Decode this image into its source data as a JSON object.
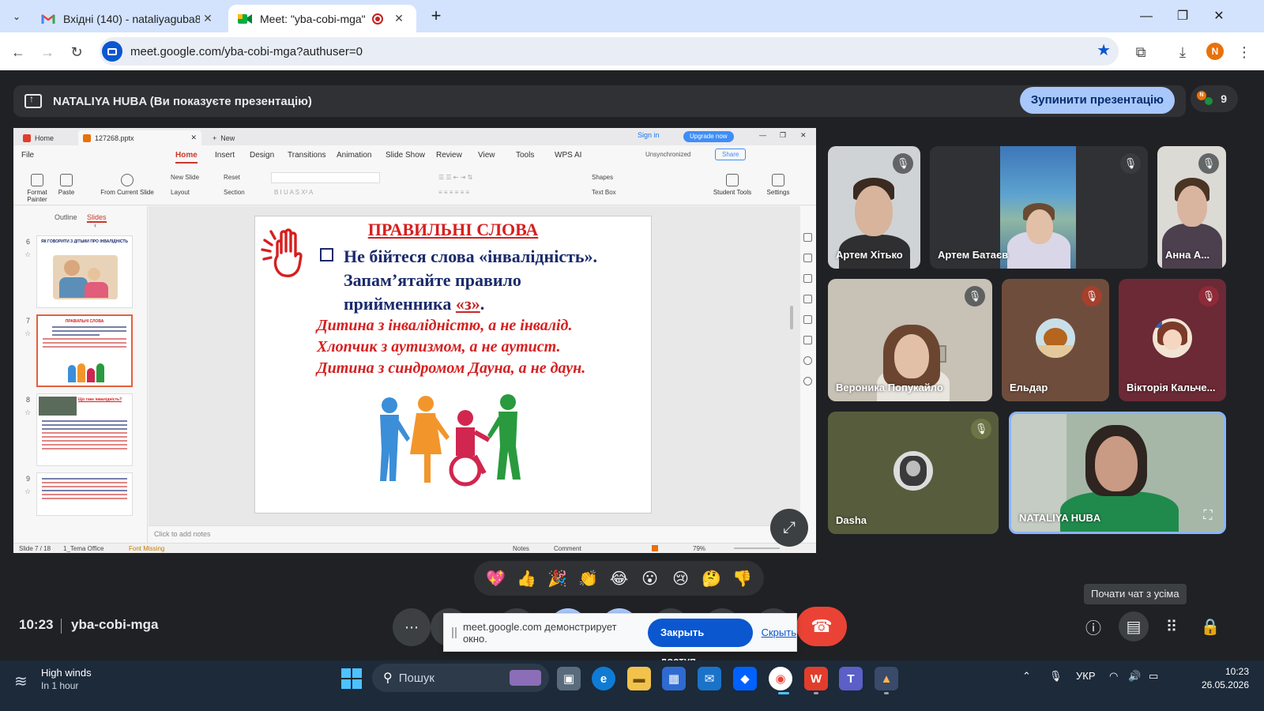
{
  "browser": {
    "tabs": [
      {
        "title": "Вхідні (140) - nataliyaguba85@",
        "active": false
      },
      {
        "title": "Meet: \"yba-cobi-mga\"",
        "active": true
      }
    ],
    "url": "meet.google.com/yba-cobi-mga?authuser=0",
    "profile_initial": "N"
  },
  "meet": {
    "presenter_banner": "NATALIYA HUBA (Ви показуєте презентацію)",
    "stop_presenting": "Зупинити презентацію",
    "participant_count": "9",
    "meeting_time": "10:23",
    "meeting_code": "yba-cobi-mga",
    "chat_tooltip": "Почати чат з усіма",
    "participants": [
      {
        "name": "Артем Хітько",
        "muted": true
      },
      {
        "name": "Артем Батаєв",
        "muted": true
      },
      {
        "name": "Анна А...",
        "muted": true
      },
      {
        "name": "Вероника Попукайло",
        "muted": true
      },
      {
        "name": "Ельдар",
        "muted": true
      },
      {
        "name": "Вікторія Кальче...",
        "muted": true
      },
      {
        "name": "Dasha",
        "muted": true
      },
      {
        "name": "NATALIYA HUBA",
        "muted": false
      }
    ],
    "reactions": [
      "💖",
      "👍",
      "🎉",
      "👏",
      "😂",
      "😮",
      "😢",
      "🤔",
      "👎"
    ],
    "share_notice": {
      "text": "meet.google.com демонстрирует окно.",
      "close_button": "Закрыть доступ",
      "hide_link": "Скрыть"
    }
  },
  "wps": {
    "tabs": [
      "Home",
      "127268.pptx",
      "New"
    ],
    "sign_in": "Sign in",
    "upgrade": "Upgrade now",
    "menu": [
      "File",
      "Home",
      "Insert",
      "Design",
      "Transitions",
      "Animation",
      "Slide Show",
      "Review",
      "View",
      "Tools",
      "WPS AI"
    ],
    "unsynchronized": "Unsynchronized",
    "share": "Share",
    "ribbon": {
      "format_painter": "Format Painter",
      "paste": "Paste",
      "from_current_slide": "From Current Slide",
      "new_slide": "New Slide",
      "layout": "Layout",
      "reset": "Reset",
      "section": "Section",
      "shapes": "Shapes",
      "text_box": "Text Box",
      "student_tools": "Student Tools",
      "settings": "Settings"
    },
    "side_tabs": [
      "Outline",
      "Slides"
    ],
    "thumbnails": [
      {
        "number": "6",
        "title": "ЯК ГОВОРИТИ З ДІТЬМИ ПРО ІНВАЛІДНІСТЬ"
      },
      {
        "number": "7",
        "title": "ПРАВИЛЬНІ СЛОВА"
      },
      {
        "number": "8",
        "title": "Що таке інвалідність?"
      },
      {
        "number": "9",
        "title": ""
      }
    ],
    "slide": {
      "title": "ПРАВИЛЬНІ СЛОВА",
      "main_line1": "Не бійтеся слова «інвалідність».",
      "main_line2": "Запам’ятайте правило",
      "main_line3_prefix": "прийменника ",
      "main_line3_highlight": "«з»",
      "main_line3_suffix": ".",
      "red_lines": [
        "Дитина з інвалідністю, а не інвалід.",
        "Хлопчик з аутизмом, а не аутист.",
        "Дитина з синдромом Дауна, а не даун."
      ]
    },
    "notes_placeholder": "Click to add notes",
    "status": {
      "slide_counter": "Slide 7 / 18",
      "theme": "1_Tema Office",
      "font_missing": "Font Missing",
      "notes": "Notes",
      "comment": "Comment",
      "zoom": "79%"
    }
  },
  "taskbar": {
    "weather_title": "High winds",
    "weather_sub": "In 1 hour",
    "search_placeholder": "Пошук",
    "language": "УКР",
    "time": "10:23",
    "date": "26.05.2026"
  }
}
